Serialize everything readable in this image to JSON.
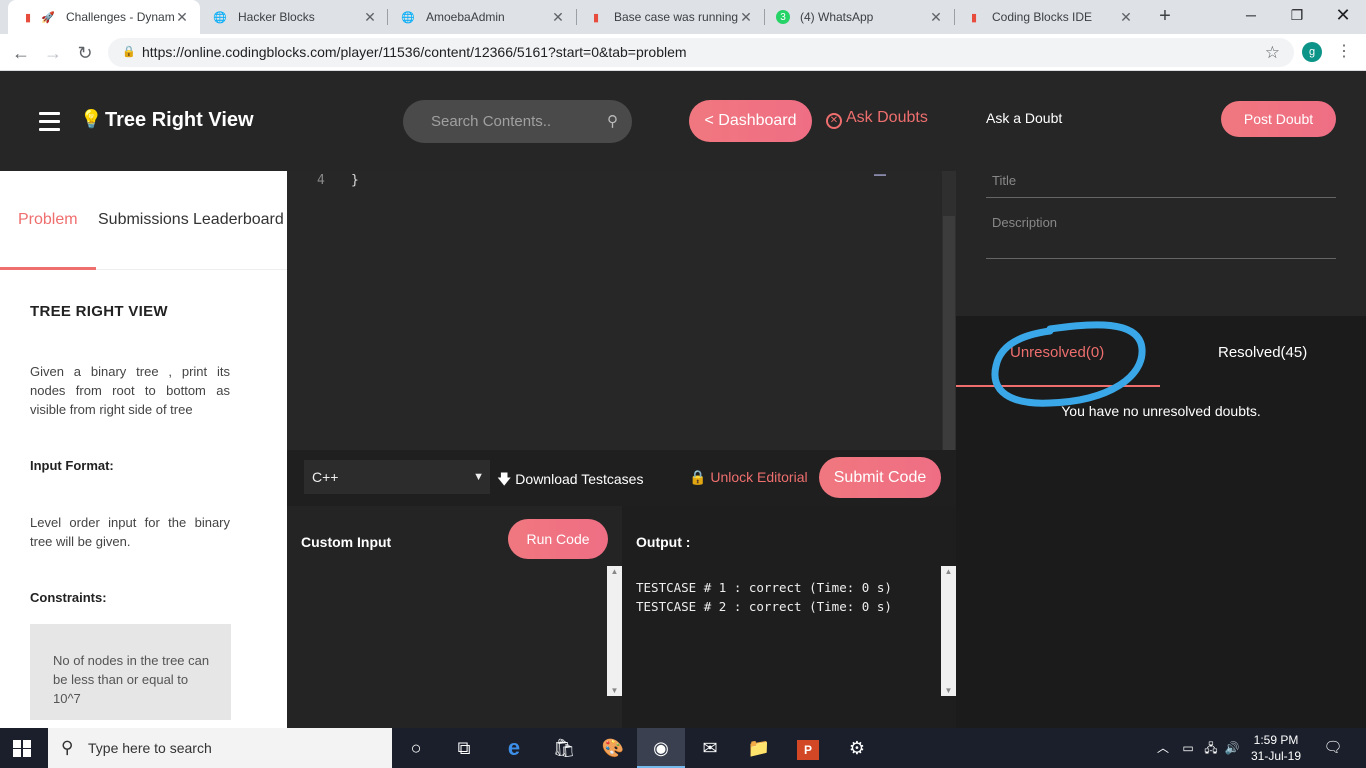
{
  "browser": {
    "tabs": [
      {
        "title": "Challenges - Dynam",
        "active": true
      },
      {
        "title": "Hacker Blocks",
        "active": false
      },
      {
        "title": "AmoebaAdmin",
        "active": false
      },
      {
        "title": "Base case was running f",
        "active": false
      },
      {
        "title": "(4) WhatsApp",
        "active": false
      },
      {
        "title": "Coding Blocks IDE",
        "active": false
      }
    ],
    "url": "https://online.codingblocks.com/player/11536/content/12366/5161?start=0&tab=problem",
    "profile_initial": "g",
    "whatsapp_badge": "3"
  },
  "header": {
    "title": "Tree Right View",
    "search_placeholder": "Search Contents..",
    "dashboard_label": "< Dashboard",
    "ask_doubts_label": "Ask Doubts"
  },
  "problem": {
    "tabs": [
      "Problem",
      "Submissions",
      "Leaderboard"
    ],
    "heading": "TREE RIGHT VIEW",
    "description": "Given a binary tree , print its nodes from root to bottom as visible from right side of tree",
    "input_format_label": "Input Format:",
    "input_format_text": "Level order input for the binary tree will be given.",
    "constraints_label": "Constraints:",
    "constraints_text": "No of nodes in the tree can be less than or equal to 10^7"
  },
  "editor": {
    "line_number": "4",
    "code_line": "}",
    "language": "C++",
    "download_label": "Download Testcases",
    "unlock_label": "Unlock Editorial",
    "submit_label": "Submit Code"
  },
  "io": {
    "custom_input_label": "Custom Input",
    "run_label": "Run Code",
    "output_label": "Output :",
    "output_lines": [
      "TESTCASE # 1 : correct (Time: 0 s)",
      "TESTCASE # 2 : correct (Time: 0 s)"
    ]
  },
  "doubts": {
    "title": "Ask a Doubt",
    "post_label": "Post Doubt",
    "title_placeholder": "Title",
    "description_placeholder": "Description",
    "unresolved_label": "Unresolved(0)",
    "resolved_label": "Resolved(45)",
    "empty_message": "You have no unresolved doubts."
  },
  "taskbar": {
    "search_placeholder": "Type here to search",
    "time": "1:59 PM",
    "date": "31-Jul-19"
  },
  "colors": {
    "accent": "#ef6e6e",
    "annotation": "#3aa8e8",
    "header_bg": "#262626"
  }
}
